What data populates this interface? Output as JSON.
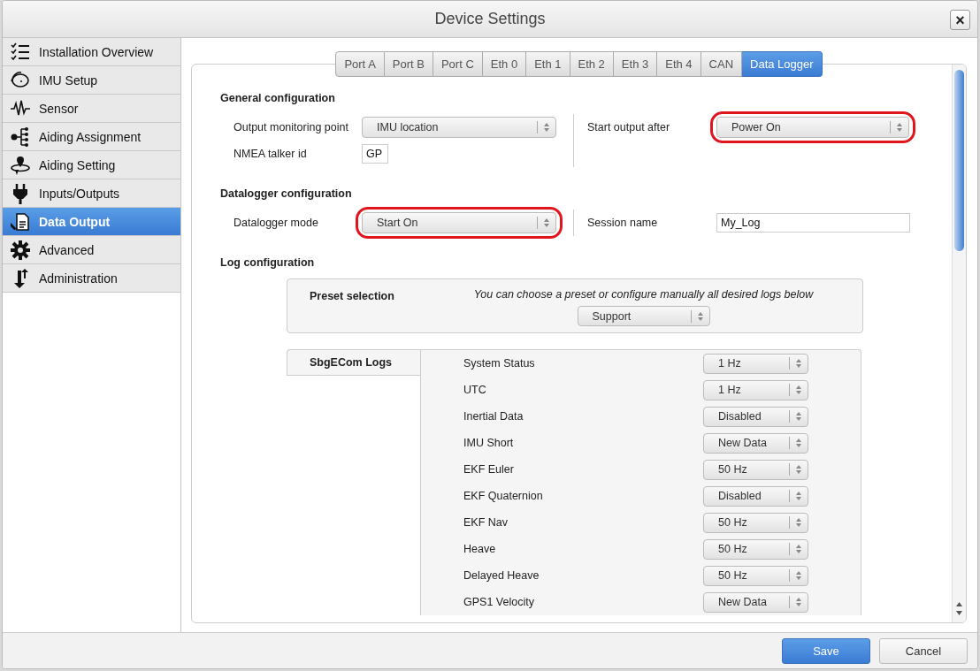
{
  "window": {
    "title": "Device Settings",
    "close": "×"
  },
  "sidebar": {
    "items": [
      {
        "label": "Installation Overview",
        "selected": false
      },
      {
        "label": "IMU Setup",
        "selected": false
      },
      {
        "label": "Sensor",
        "selected": false
      },
      {
        "label": "Aiding Assignment",
        "selected": false
      },
      {
        "label": "Aiding Setting",
        "selected": false
      },
      {
        "label": "Inputs/Outputs",
        "selected": false
      },
      {
        "label": "Data Output",
        "selected": true
      },
      {
        "label": "Advanced",
        "selected": false
      },
      {
        "label": "Administration",
        "selected": false
      }
    ]
  },
  "tabs": [
    {
      "label": "Port A",
      "selected": false
    },
    {
      "label": "Port B",
      "selected": false
    },
    {
      "label": "Port C",
      "selected": false
    },
    {
      "label": "Eth 0",
      "selected": false
    },
    {
      "label": "Eth 1",
      "selected": false
    },
    {
      "label": "Eth 2",
      "selected": false
    },
    {
      "label": "Eth 3",
      "selected": false
    },
    {
      "label": "Eth 4",
      "selected": false
    },
    {
      "label": "CAN",
      "selected": false
    },
    {
      "label": "Data Logger",
      "selected": true
    }
  ],
  "sections": [
    {
      "title": "General configuration",
      "left": [
        {
          "kind": "select",
          "label": "Output monitoring point",
          "value": "IMU location",
          "highlighted": false
        },
        {
          "kind": "text",
          "label": "NMEA talker id",
          "value": "GP"
        }
      ],
      "right": [
        {
          "kind": "select",
          "label": "Start output after",
          "value": "Power On",
          "highlighted": true
        }
      ]
    },
    {
      "title": "Datalogger configuration",
      "left": [
        {
          "kind": "select",
          "label": "Datalogger mode",
          "value": "Start On",
          "highlighted": true
        }
      ],
      "right": [
        {
          "kind": "text",
          "label": "Session name",
          "value": "My_Log"
        }
      ]
    }
  ],
  "log_configuration": {
    "title": "Log configuration",
    "preset": {
      "label": "Preset selection",
      "hint": "You can choose a preset or configure manually all desired logs below",
      "value": "Support"
    },
    "logs": {
      "tab": "SbgECom Logs",
      "rows": [
        {
          "name": "System Status",
          "value": "1 Hz"
        },
        {
          "name": "UTC",
          "value": "1 Hz"
        },
        {
          "name": "Inertial Data",
          "value": "Disabled"
        },
        {
          "name": "IMU Short",
          "value": "New Data"
        },
        {
          "name": "EKF Euler",
          "value": "50 Hz"
        },
        {
          "name": "EKF Quaternion",
          "value": "Disabled"
        },
        {
          "name": "EKF Nav",
          "value": "50 Hz"
        },
        {
          "name": "Heave",
          "value": "50 Hz"
        },
        {
          "name": "Delayed Heave",
          "value": "50 Hz"
        },
        {
          "name": "GPS1 Velocity",
          "value": "New Data"
        }
      ]
    }
  },
  "buttons": [
    {
      "label": "Save",
      "kind": "primary"
    },
    {
      "label": "Cancel",
      "kind": "secondary"
    }
  ]
}
